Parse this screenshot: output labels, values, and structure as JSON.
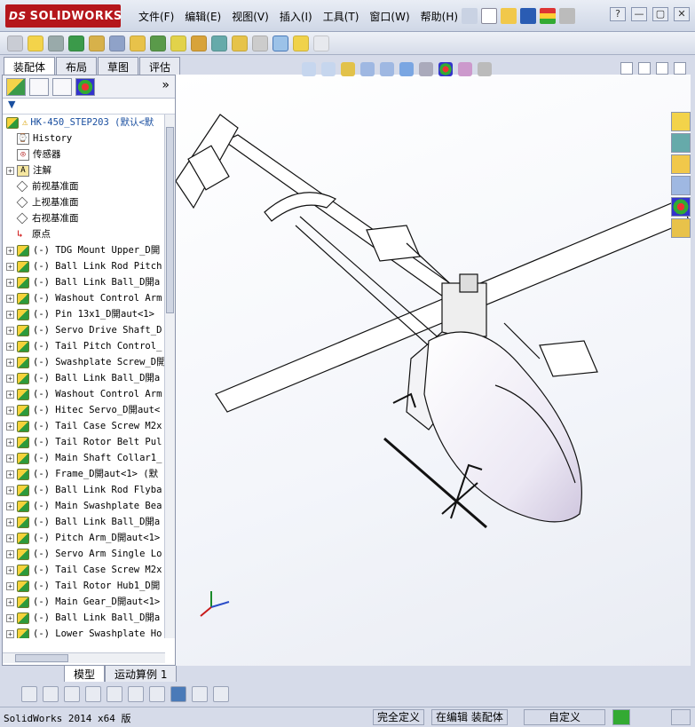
{
  "app": {
    "logo_text": "SOLIDWORKS",
    "logo_prefix": "DS"
  },
  "menu": [
    "文件(F)",
    "编辑(E)",
    "视图(V)",
    "插入(I)",
    "工具(T)",
    "窗口(W)",
    "帮助(H)"
  ],
  "window_buttons": [
    "?",
    "—",
    "▢",
    "✕"
  ],
  "tabs": [
    "装配体",
    "布局",
    "草图",
    "评估"
  ],
  "tree": {
    "filter_label": "▼",
    "root": "HK-450_STEP203  (默认<默",
    "fixed": [
      {
        "label": "History",
        "icon": "history-icon"
      },
      {
        "label": "传感器",
        "icon": "sensor-icon"
      },
      {
        "label": "注解",
        "icon": "annotation-icon"
      },
      {
        "label": "前视基准面",
        "icon": "plane-icon"
      },
      {
        "label": "上视基准面",
        "icon": "plane-icon"
      },
      {
        "label": "右视基准面",
        "icon": "plane-icon"
      },
      {
        "label": "原点",
        "icon": "origin-icon"
      }
    ],
    "parts": [
      "(-) TDG Mount Upper_D開",
      "(-) Ball Link Rod Pitch",
      "(-) Ball Link Ball_D開a",
      "(-) Washout Control Arm",
      "(-) Pin 13x1_D開aut<1>",
      "(-) Servo Drive Shaft_D",
      "(-) Tail Pitch Control_",
      "(-) Swashplate Screw_D開",
      "(-) Ball Link Ball_D開a",
      "(-) Washout Control Arm",
      "(-) Hitec Servo_D開aut<",
      "(-) Tail Case Screw M2x",
      "(-) Tail Rotor Belt Pul",
      "(-) Main Shaft Collar1_",
      "(-) Frame_D開aut<1> (默",
      "(-) Ball Link Rod Flyba",
      "(-) Main Swashplate Bea",
      "(-) Ball Link Ball_D開a",
      "(-) Pitch Arm_D開aut<1>",
      "(-) Servo Arm Single Lo",
      "(-) Tail Case Screw M2x",
      "(-) Tail Rotor Hub1_D開",
      "(-) Main Gear_D開aut<1>",
      "(-) Ball Link Ball_D開a",
      "(-) Lower Swashplate Ho"
    ]
  },
  "bottom_tabs": [
    "模型",
    "运动算例 1"
  ],
  "status": {
    "app_version": "SolidWorks 2014 x64 版",
    "definition": "完全定义",
    "editing": "在编辑 装配体",
    "custom": "自定义"
  },
  "colors": {
    "logo_bg": "#b5161b",
    "chrome": "#d6dbe9",
    "accent": "#1a4fa0"
  }
}
